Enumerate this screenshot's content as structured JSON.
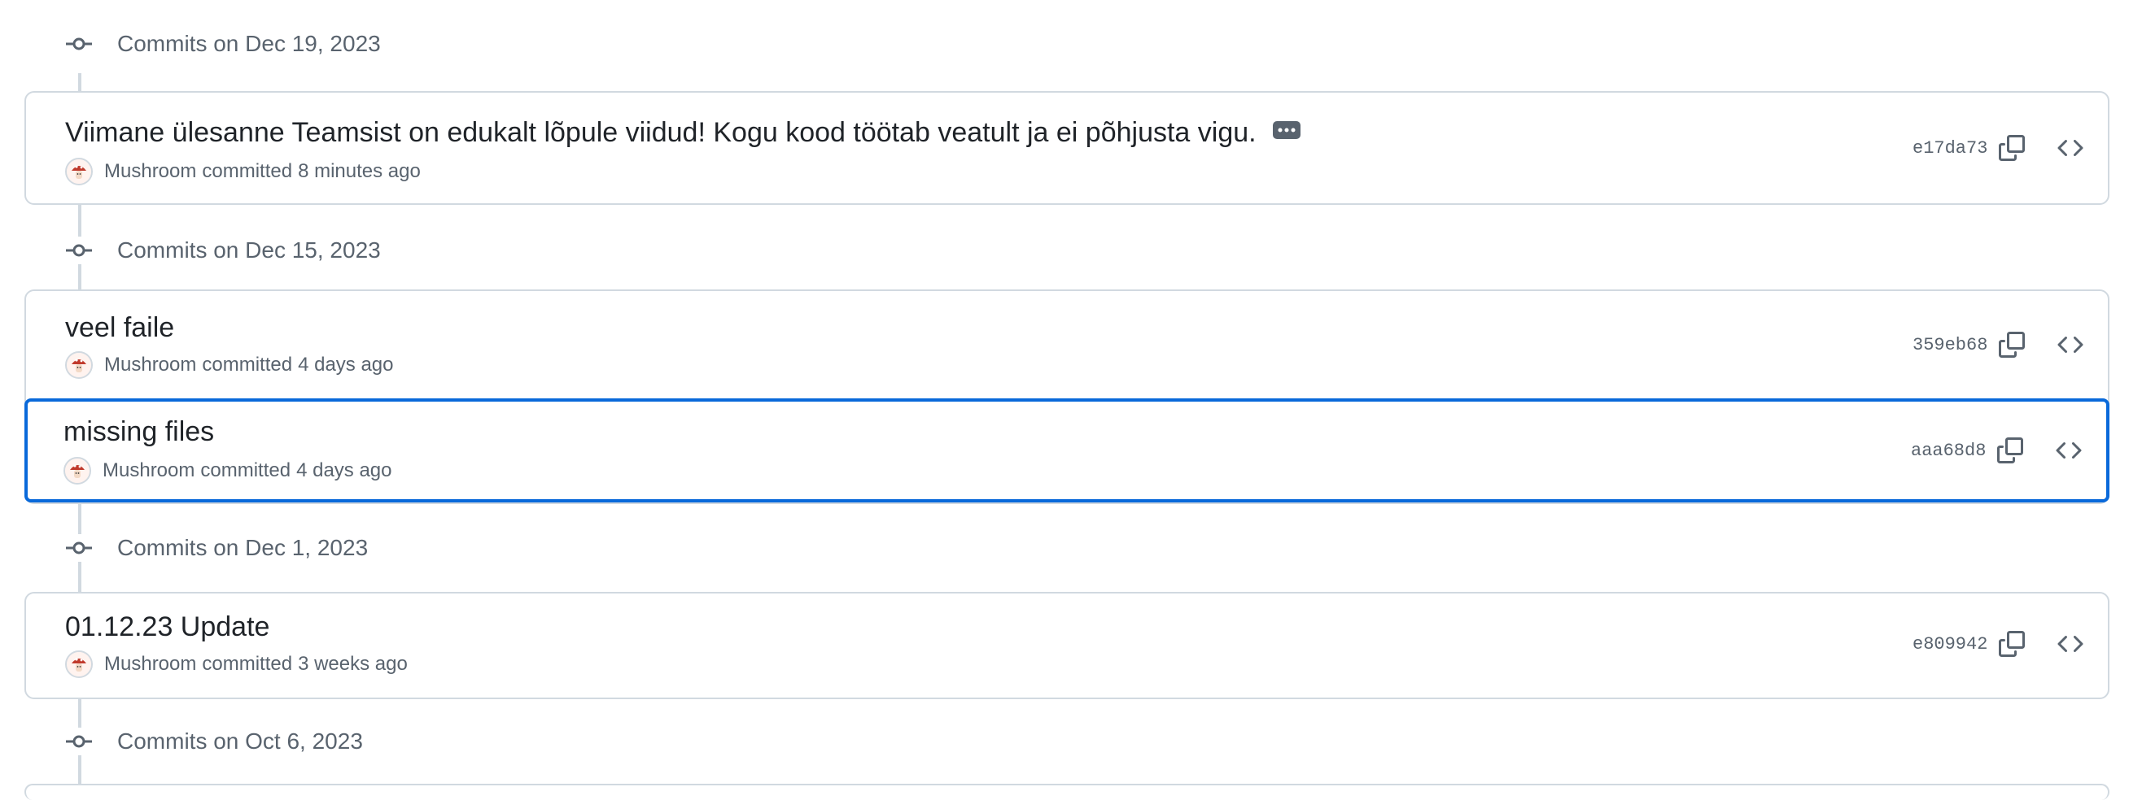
{
  "groups": [
    {
      "label": "Commits on Dec 19, 2023",
      "commits": [
        {
          "title": "Viimane ülesanne Teamsist on edukalt lõpule viidud! Kogu kood töötab veatult ja ei põhjusta vigu.",
          "has_more_button": true,
          "author": "Mushroom",
          "action": "committed",
          "time": "8 minutes ago",
          "sha": "e17da73"
        }
      ]
    },
    {
      "label": "Commits on Dec 15, 2023",
      "commits": [
        {
          "title": "veel faile",
          "author": "Mushroom",
          "action": "committed",
          "time": "4 days ago",
          "sha": "359eb68"
        },
        {
          "title": "missing files",
          "author": "Mushroom",
          "action": "committed",
          "time": "4 days ago",
          "sha": "aaa68d8",
          "focused": true
        }
      ]
    },
    {
      "label": "Commits on Dec 1, 2023",
      "commits": [
        {
          "title": "01.12.23 Update",
          "author": "Mushroom",
          "action": "committed",
          "time": "3 weeks ago",
          "sha": "e809942"
        }
      ]
    },
    {
      "label": "Commits on Oct 6, 2023",
      "commits": []
    }
  ],
  "icons": {
    "timeline": "git-commit-icon",
    "more": "kebab-horizontal-icon",
    "copy": "copy-icon",
    "browse": "code-icon"
  },
  "colors": {
    "focus": "#0969da",
    "border": "#d1d9e0",
    "muted": "#59636e",
    "text": "#1f2328"
  }
}
